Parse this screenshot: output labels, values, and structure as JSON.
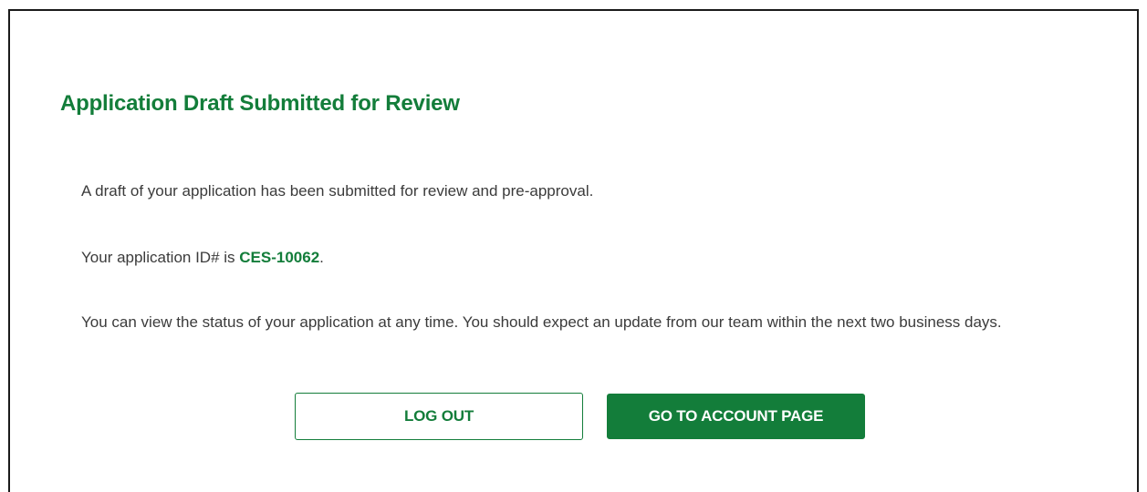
{
  "dialog": {
    "title": "Application Draft Submitted for Review",
    "line1": "A draft of your application has been submitted for review and pre-approval.",
    "line2_prefix": "Your application ID# is ",
    "application_id": "CES-10062",
    "line2_suffix": ".",
    "line3": "You can view the status of your application at any time. You should expect an update from our team within the next two business days."
  },
  "actions": {
    "logout_label": "LOG OUT",
    "account_label": "GO TO ACCOUNT PAGE"
  },
  "colors": {
    "brand_green": "#137d3a",
    "body_text": "#3b3b3b"
  }
}
